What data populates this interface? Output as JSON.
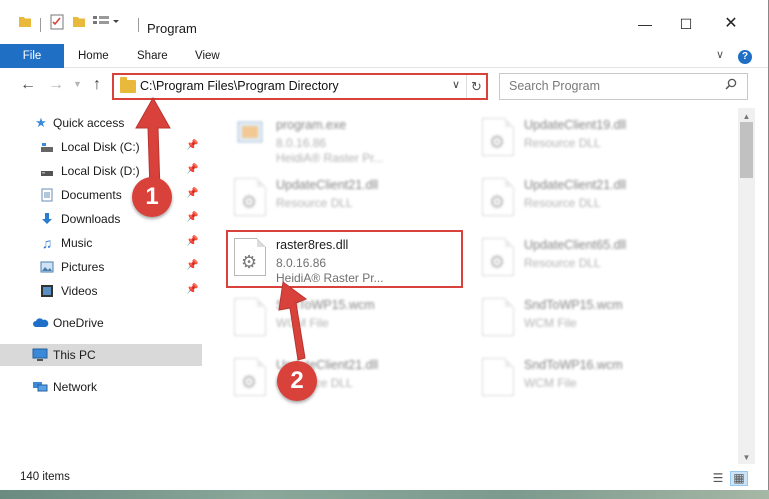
{
  "window": {
    "title": "Program"
  },
  "ribbon": {
    "tabs": [
      "File",
      "Home",
      "Share",
      "View"
    ],
    "help": "?"
  },
  "address": {
    "path": "C:\\Program Files\\Program Directory"
  },
  "search": {
    "placeholder": "Search Program"
  },
  "sidebar": {
    "items": [
      {
        "label": "Quick access",
        "icon": "star-icon"
      },
      {
        "label": "Local Disk (C:)",
        "icon": "drive-icon"
      },
      {
        "label": "Local Disk (D:)",
        "icon": "drive-icon"
      },
      {
        "label": "Documents",
        "icon": "documents-icon"
      },
      {
        "label": "Downloads",
        "icon": "download-icon"
      },
      {
        "label": "Music",
        "icon": "music-icon"
      },
      {
        "label": "Pictures",
        "icon": "pictures-icon"
      },
      {
        "label": "Videos",
        "icon": "videos-icon"
      },
      {
        "label": "OneDrive",
        "icon": "cloud-icon"
      },
      {
        "label": "This PC",
        "icon": "computer-icon"
      },
      {
        "label": "Network",
        "icon": "network-icon"
      }
    ]
  },
  "files": [
    {
      "name": "program.exe",
      "line2": "8.0.16.86",
      "line3": "HeidiA® Raster Pr..."
    },
    {
      "name": "UpdateClient19.dll",
      "line2": "Resource DLL",
      "line3": ""
    },
    {
      "name": "UpdateClient21.dll",
      "line2": "Resource DLL",
      "line3": ""
    },
    {
      "name": "UpdateClient21.dll",
      "line2": "Resource DLL",
      "line3": ""
    },
    {
      "name": "raster8res.dll",
      "line2": "8.0.16.86",
      "line3": "HeidiA® Raster Pr..."
    },
    {
      "name": "UpdateClient65.dll",
      "line2": "Resource DLL",
      "line3": ""
    },
    {
      "name": "SndToWP15.wcm",
      "line2": "WCM File",
      "line3": ""
    },
    {
      "name": "SndToWP15.wcm",
      "line2": "WCM File",
      "line3": ""
    },
    {
      "name": "UpdateClient21.dll",
      "line2": "Resource DLL",
      "line3": ""
    },
    {
      "name": "SndToWP16.wcm",
      "line2": "WCM File",
      "line3": ""
    }
  ],
  "status": {
    "items_count": "140 items"
  },
  "annotations": {
    "step1": "1",
    "step2": "2",
    "color": "#d9413b"
  }
}
